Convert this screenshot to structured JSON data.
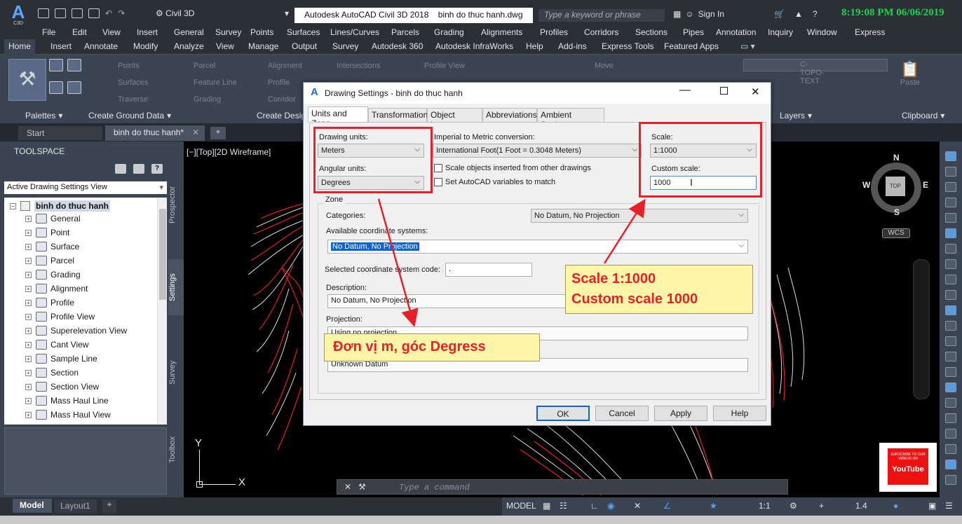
{
  "titlebar": {
    "app_logo": "A",
    "app_logo_sub": "C3D",
    "workspace": "Civil 3D",
    "window_title": "Autodesk AutoCAD Civil 3D 2018    binh do thuc hanh.dwg",
    "search_placeholder": "Type a keyword or phrase",
    "signin": "Sign In",
    "clock": "8:19:08 PM 06/06/2019"
  },
  "menubar": [
    "File",
    "Edit",
    "View",
    "Insert",
    "General",
    "Survey",
    "Points",
    "Surfaces",
    "Lines/Curves",
    "Parcels",
    "Grading",
    "Alignments",
    "Profiles",
    "Corridors",
    "Sections",
    "Pipes",
    "Annotation",
    "Inquiry",
    "Window",
    "Express"
  ],
  "ribbon_tabs": [
    "Home",
    "Insert",
    "Annotate",
    "Modify",
    "Analyze",
    "View",
    "Manage",
    "Output",
    "Survey",
    "Autodesk 360",
    "Autodesk InfraWorks",
    "Help",
    "Add-ins",
    "Express Tools",
    "Featured Apps"
  ],
  "ribbon": {
    "buttons": [
      "Points",
      "Surfaces",
      "Traverse",
      "Parcel",
      "Feature Line",
      "Grading",
      "Alignment",
      "Profile",
      "Corridor",
      "Intersections",
      "Profile View",
      "Move",
      "C-TOPO-TEXT",
      "Paste"
    ],
    "panels": [
      "Palettes",
      "Create Ground Data",
      "Create Design",
      "Layers",
      "Clipboard"
    ]
  },
  "doc_tabs": {
    "start": "Start",
    "active": "binh do thuc hanh*",
    "plus": "+"
  },
  "toolspace": {
    "title": "TOOLSPACE",
    "view_select": "Active Drawing Settings View",
    "root": "binh do thuc hanh",
    "items": [
      "General",
      "Point",
      "Surface",
      "Parcel",
      "Grading",
      "Alignment",
      "Profile",
      "Profile View",
      "Superelevation View",
      "Cant View",
      "Sample Line",
      "Section",
      "Section View",
      "Mass Haul Line",
      "Mass Haul View"
    ],
    "side_tabs": [
      "Prospector",
      "Settings",
      "Survey",
      "Toolbox"
    ]
  },
  "viewport": {
    "label": "[−][Top][2D Wireframe]",
    "compass": {
      "n": "N",
      "s": "S",
      "e": "E",
      "w": "W",
      "top": "TOP",
      "wcs": "WCS"
    },
    "axis_x": "X",
    "axis_y": "Y",
    "command_placeholder": "Type a command",
    "youtube_sub": "SUBSCRIBE TO OUR VIDEOS ON",
    "youtube": "YouTube"
  },
  "dialog": {
    "title": "Drawing Settings - binh do thuc hanh",
    "tabs": [
      "Units and Zone",
      "Transformation",
      "Object Layers",
      "Abbreviations",
      "Ambient Settings"
    ],
    "drawing_units_label": "Drawing units:",
    "drawing_units": "Meters",
    "angular_units_label": "Angular units:",
    "angular_units": "Degrees",
    "imperial_label": "Imperial to Metric conversion:",
    "imperial": "International Foot(1 Foot = 0.3048 Meters)",
    "scale_objects": "Scale objects inserted from other drawings",
    "set_vars": "Set AutoCAD variables to match",
    "scale_label": "Scale:",
    "scale": "1:1000",
    "custom_scale_label": "Custom scale:",
    "custom_scale": "1000",
    "zone": "Zone",
    "categories_label": "Categories:",
    "categories": "No Datum, No Projection",
    "available_label": "Available coordinate systems:",
    "available": "No Datum, No Projection",
    "selected_code_label": "Selected coordinate system code:",
    "selected_code": ".",
    "description_label": "Description:",
    "description": "No Datum, No Projection",
    "projection_label": "Projection:",
    "projection": "Using no projection",
    "datum": "Unknown Datum",
    "ok": "OK",
    "cancel": "Cancel",
    "apply": "Apply",
    "help": "Help"
  },
  "callouts": {
    "scale_line1": "Scale 1:1000",
    "scale_line2": "Custom scale 1000",
    "units": "Đơn vị m, góc Degress"
  },
  "statusbar": {
    "model_tab": "Model",
    "layout_tab": "Layout1",
    "model": "MODEL",
    "scale": "1:1",
    "lineweight": "1.4"
  },
  "colors": {
    "accent_red": "#e8202a",
    "callout_bg": "#fdf6a8",
    "dark_bg": "#2b2f36",
    "ribbon_bg": "#3b4453"
  }
}
